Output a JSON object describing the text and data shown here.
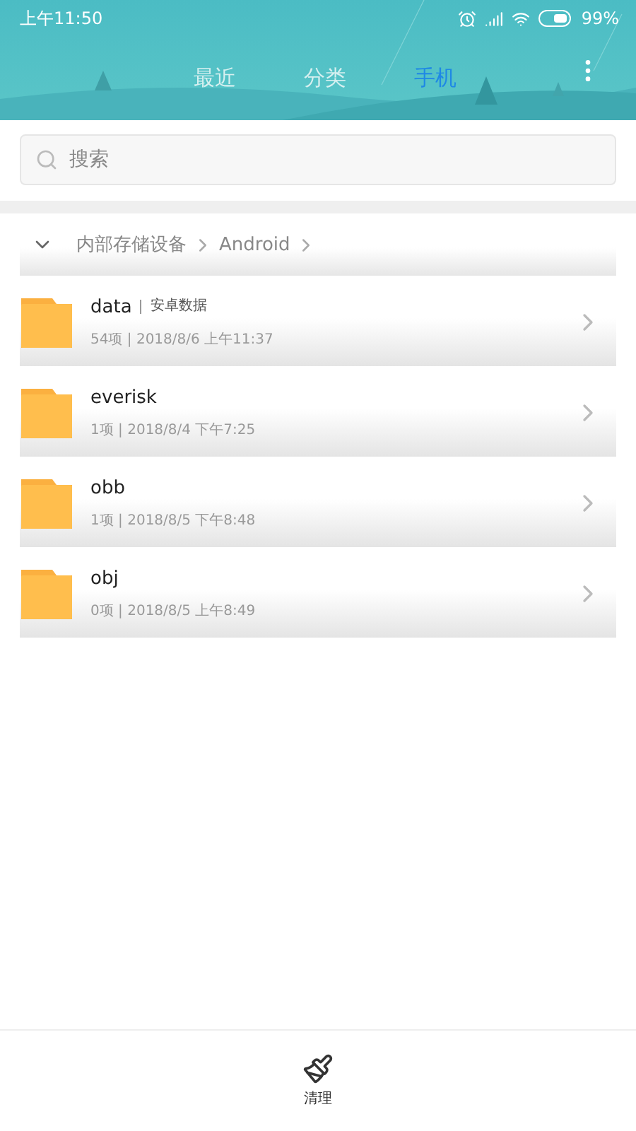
{
  "status_bar": {
    "time": "上午11:50",
    "battery": "99%"
  },
  "tabs": [
    {
      "label": "最近",
      "selected": false
    },
    {
      "label": "分类",
      "selected": false
    },
    {
      "label": "手机",
      "selected": true
    }
  ],
  "search": {
    "placeholder": "搜索"
  },
  "breadcrumb": {
    "expanded": true,
    "items": [
      "内部存储设备",
      "Android"
    ]
  },
  "folders": [
    {
      "name": "data",
      "note": "安卓数据",
      "meta": "54项 | 2018/8/6 上午11:37"
    },
    {
      "name": "everisk",
      "meta": "1项 | 2018/8/4 下午7:25"
    },
    {
      "name": "obb",
      "meta": "1项 | 2018/8/5 下午8:48"
    },
    {
      "name": "obj",
      "meta": "0项 | 2018/8/5 上午8:49"
    }
  ],
  "bottom_bar": {
    "label": "清理"
  }
}
